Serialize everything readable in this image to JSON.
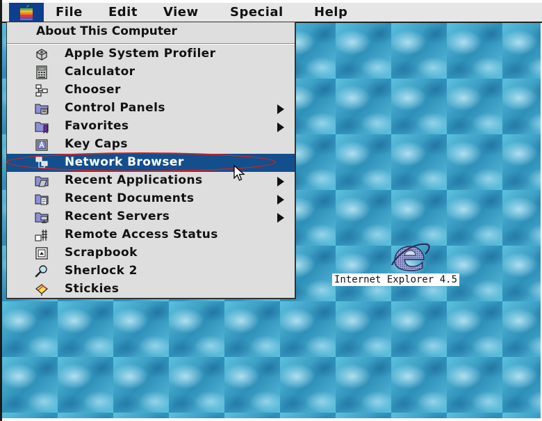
{
  "menubar": {
    "apple_menu_icon": "apple-logo-icon",
    "items": [
      {
        "label": "File"
      },
      {
        "label": "Edit"
      },
      {
        "label": "View"
      },
      {
        "label": "Special"
      },
      {
        "label": "Help"
      }
    ]
  },
  "apple_menu": {
    "about": "About This Computer",
    "items": [
      {
        "label": "Apple System Profiler",
        "icon": "system-profiler-icon",
        "submenu": false
      },
      {
        "label": "Calculator",
        "icon": "calculator-icon",
        "submenu": false
      },
      {
        "label": "Chooser",
        "icon": "chooser-icon",
        "submenu": false
      },
      {
        "label": "Control Panels",
        "icon": "control-panels-folder-icon",
        "submenu": true
      },
      {
        "label": "Favorites",
        "icon": "favorites-folder-icon",
        "submenu": true
      },
      {
        "label": "Key Caps",
        "icon": "key-caps-icon",
        "submenu": false
      },
      {
        "label": "Network Browser",
        "icon": "network-browser-icon",
        "submenu": false,
        "selected": true
      },
      {
        "label": "Recent Applications",
        "icon": "recent-applications-folder-icon",
        "submenu": true
      },
      {
        "label": "Recent Documents",
        "icon": "recent-documents-folder-icon",
        "submenu": true
      },
      {
        "label": "Recent Servers",
        "icon": "recent-servers-folder-icon",
        "submenu": true
      },
      {
        "label": "Remote Access Status",
        "icon": "remote-access-icon",
        "submenu": false
      },
      {
        "label": "Scrapbook",
        "icon": "scrapbook-icon",
        "submenu": false
      },
      {
        "label": "Sherlock 2",
        "icon": "sherlock-magnifier-icon",
        "submenu": false
      },
      {
        "label": "Stickies",
        "icon": "stickies-icon",
        "submenu": false
      }
    ]
  },
  "desktop": {
    "icons": [
      {
        "label": "Internet Explorer 4.5",
        "icon": "internet-explorer-icon"
      }
    ]
  },
  "colors": {
    "selection": "#134f8d",
    "highlight_ring": "#d61f1f",
    "menu_bg": "#dedede",
    "desktop_bg": "#3ea6c8"
  }
}
